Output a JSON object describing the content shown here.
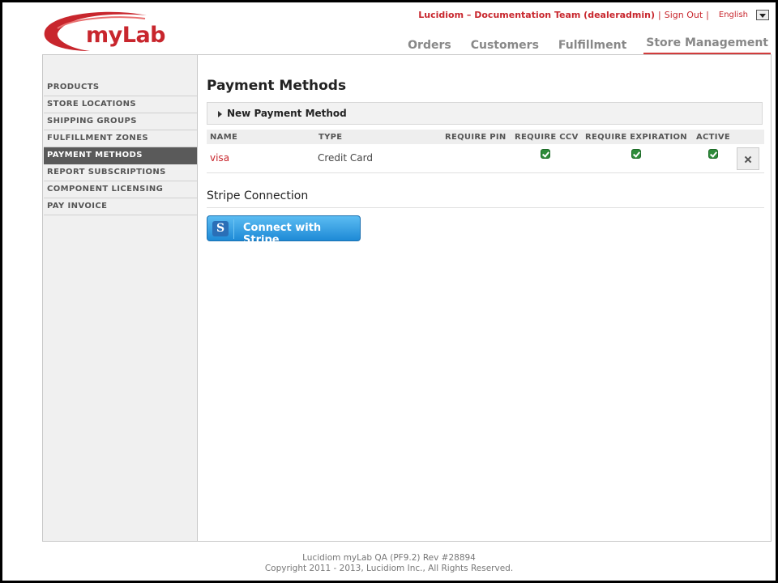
{
  "brand": {
    "logo_text": "myLab",
    "brand_color": "#c8262d"
  },
  "user_bar": {
    "user": "Lucidiom – Documentation Team (dealeradmin)",
    "separator": "|",
    "sign_out": "Sign Out",
    "language": "English"
  },
  "top_nav": {
    "items": [
      {
        "label": "Orders",
        "active": false
      },
      {
        "label": "Customers",
        "active": false
      },
      {
        "label": "Fulfillment",
        "active": false
      },
      {
        "label": "Store Management",
        "active": true
      }
    ]
  },
  "sidebar": {
    "items": [
      {
        "label": "PRODUCTS",
        "active": false
      },
      {
        "label": "STORE LOCATIONS",
        "active": false
      },
      {
        "label": "SHIPPING GROUPS",
        "active": false
      },
      {
        "label": "FULFILLMENT ZONES",
        "active": false
      },
      {
        "label": "PAYMENT METHODS",
        "active": true
      },
      {
        "label": "REPORT SUBSCRIPTIONS",
        "active": false
      },
      {
        "label": "COMPONENT LICENSING",
        "active": false
      },
      {
        "label": "PAY INVOICE",
        "active": false
      }
    ]
  },
  "main": {
    "title": "Payment Methods",
    "new_method_label": "New Payment Method",
    "table": {
      "columns": [
        "NAME",
        "TYPE",
        "REQUIRE PIN",
        "REQUIRE CCV",
        "REQUIRE EXPIRATION",
        "ACTIVE"
      ],
      "rows": [
        {
          "name": "visa",
          "type": "Credit Card",
          "require_pin": false,
          "require_ccv": true,
          "require_expiration": true,
          "active": true
        }
      ]
    },
    "stripe": {
      "section_title": "Stripe Connection",
      "button_label": "Connect with Stripe",
      "logo_letter": "S"
    }
  },
  "footer": {
    "line1": "Lucidiom myLab QA (PF9.2) Rev #28894",
    "line2": "Copyright 2011 - 2013, Lucidiom Inc., All Rights Reserved."
  }
}
